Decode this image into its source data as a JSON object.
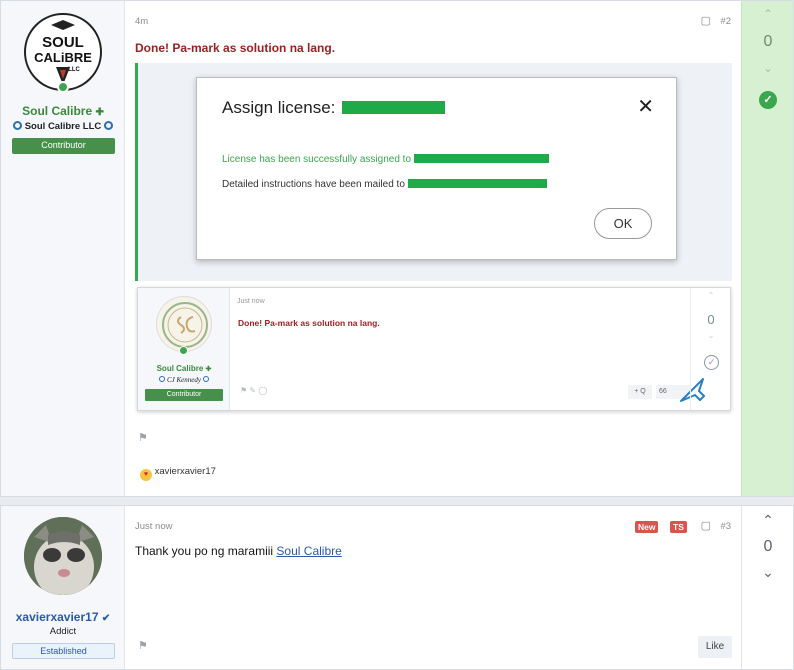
{
  "post2": {
    "time": "4m",
    "number": "#2",
    "user": {
      "logo_line1": "SOUL",
      "logo_line2": "CALiBRE",
      "logo_line3": "LLC",
      "name": "Soul Calibre",
      "company": "Soul Calibre LLC",
      "banner": "Contributor"
    },
    "message": "Done! Pa-mark as solution na lang.",
    "screenshot": {
      "dialog_title": "Assign license:",
      "success_text": "License has been successfully assigned to",
      "mailed_text": "Detailed instructions have been mailed to",
      "ok_label": "OK",
      "nested_post": {
        "time": "Just now",
        "message": "Done! Pa-mark as solution na lang.",
        "name": "Soul Calibre",
        "company": "CJ Kennedy",
        "banner": "Contributor",
        "vote": "0",
        "quote": "+ Q",
        "reply": "66"
      }
    },
    "reaction_user": "xavierxavier17",
    "vote": "0",
    "accent_green": "#3aa64d"
  },
  "post3": {
    "time": "Just now",
    "number": "#3",
    "badge_new": "New",
    "badge_ts": "TS",
    "user": {
      "name": "xavierxavier17",
      "title": "Addict",
      "banner": "Established"
    },
    "message_prefix": "Thank you po ng maramiii",
    "mention": "Soul Calibre",
    "vote": "0",
    "like_label": "Like"
  }
}
